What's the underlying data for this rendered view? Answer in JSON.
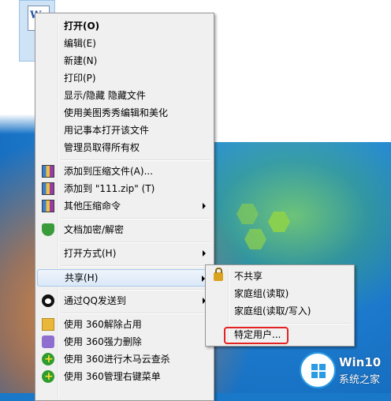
{
  "main_menu": {
    "items": [
      {
        "label": "打开(O)",
        "bold": true
      },
      {
        "label": "编辑(E)"
      },
      {
        "label": "新建(N)"
      },
      {
        "label": "打印(P)"
      },
      {
        "label": "显示/隐藏 隐藏文件"
      },
      {
        "label": "使用美图秀秀编辑和美化"
      },
      {
        "label": "用记事本打开该文件"
      },
      {
        "label": "管理员取得所有权"
      },
      {
        "label": "添加到压缩文件(A)..."
      },
      {
        "label": "添加到 \"111.zip\" (T)"
      },
      {
        "label": "其他压缩命令"
      },
      {
        "label": "文档加密/解密"
      },
      {
        "label": "打开方式(H)"
      },
      {
        "label": "共享(H)"
      },
      {
        "label": "通过QQ发送到"
      },
      {
        "label": "使用 360解除占用"
      },
      {
        "label": "使用 360强力删除"
      },
      {
        "label": "使用 360进行木马云查杀"
      },
      {
        "label": "使用 360管理右键菜单"
      }
    ]
  },
  "share_submenu": {
    "items": [
      {
        "label": "不共享"
      },
      {
        "label": "家庭组(读取)"
      },
      {
        "label": "家庭组(读取/写入)"
      },
      {
        "label": "特定用户..."
      }
    ]
  },
  "watermark": {
    "title": "Win10",
    "subtitle": "系统之家"
  },
  "colors": {
    "highlight_border": "#a8c8ea",
    "annotation_red": "#e52222",
    "desktop_blue": "#1a78c9"
  }
}
